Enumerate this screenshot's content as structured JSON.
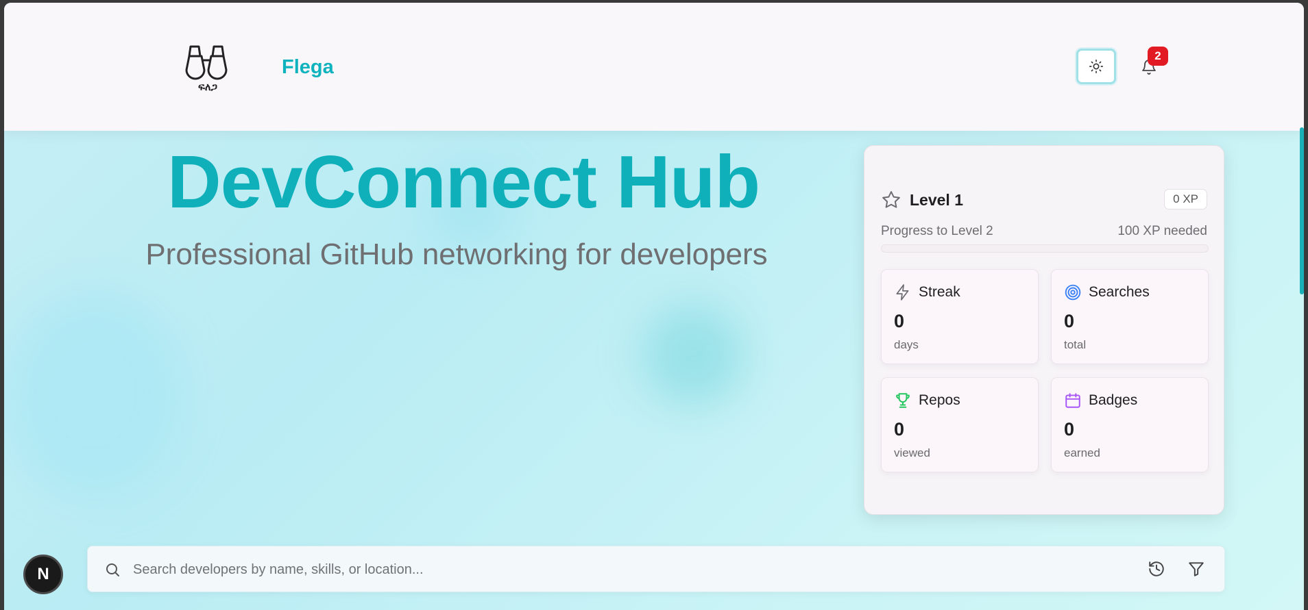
{
  "header": {
    "logo_text": "ፍለጋ",
    "brand": "Flega",
    "notification_count": "2"
  },
  "hero": {
    "title": "DevConnect Hub",
    "subtitle": "Professional GitHub networking for developers"
  },
  "progress_panel": {
    "level_label": "Level 1",
    "xp_badge": "0 XP",
    "progress_label": "Progress to Level 2",
    "needed_label": "100 XP needed",
    "progress_fraction": 0,
    "stats": [
      {
        "label": "Streak",
        "value": "0",
        "unit": "days",
        "icon": "lightning-icon"
      },
      {
        "label": "Searches",
        "value": "0",
        "unit": "total",
        "icon": "target-icon"
      },
      {
        "label": "Repos",
        "value": "0",
        "unit": "viewed",
        "icon": "trophy-icon"
      },
      {
        "label": "Badges",
        "value": "0",
        "unit": "earned",
        "icon": "calendar-icon"
      }
    ]
  },
  "search": {
    "placeholder": "Search developers by name, skills, or location..."
  },
  "floating": {
    "n_label": "N"
  },
  "colors": {
    "accent": "#0fb3bd",
    "badge_red": "#e21a23",
    "target_blue": "#3b82f6",
    "trophy_green": "#22c55e",
    "calendar_purple": "#a855f7"
  }
}
